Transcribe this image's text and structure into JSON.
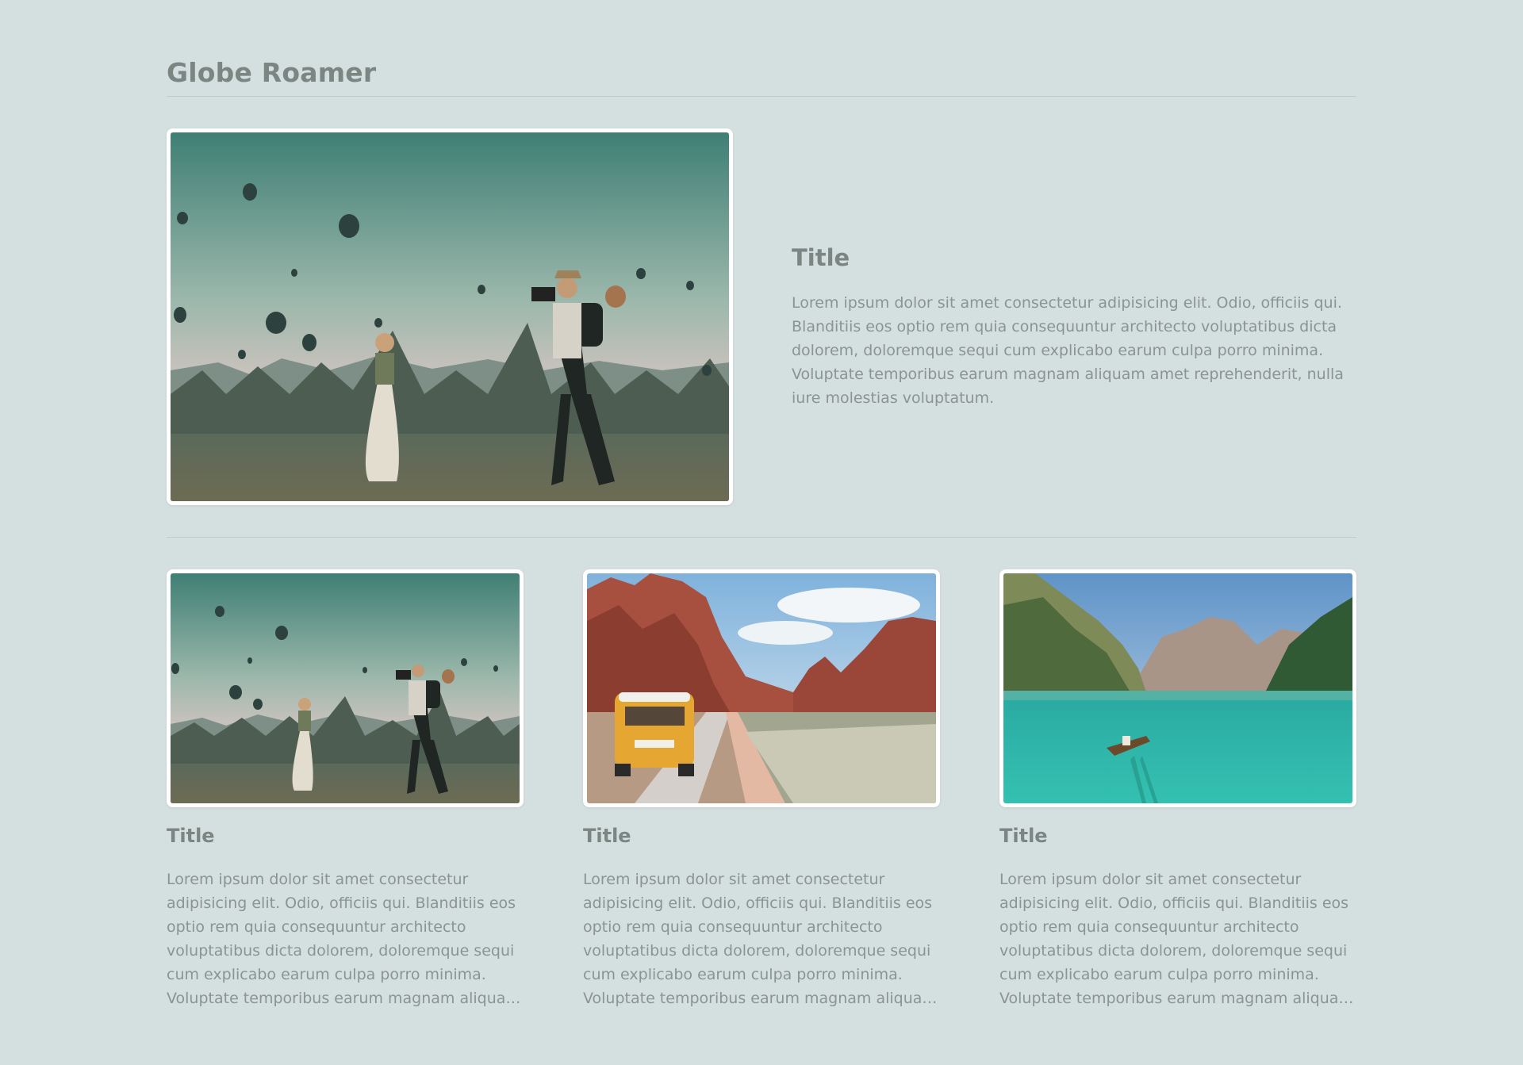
{
  "site": {
    "title": "Globe Roamer"
  },
  "featured": {
    "title": "Title",
    "body": "Lorem ipsum dolor sit amet consectetur adipisicing elit. Odio, officiis qui. Blanditiis eos optio rem quia consequuntur architecto voluptatibus dicta dolorem, doloremque sequi cum explicabo earum culpa porro minima. Voluptate temporibus earum magnam aliquam amet reprehenderit, nulla iure molestias voluptatum.",
    "image": "hot-air-balloons-photographers"
  },
  "cards": [
    {
      "title": "Title",
      "body": "Lorem ipsum dolor sit amet consectetur adipisicing elit. Odio, officiis qui. Blanditiis eos optio rem quia consequuntur architecto voluptatibus dicta dolorem, doloremque sequi cum explicabo earum culpa porro minima. Voluptate temporibus earum magnam aliquam amet reprehenderit, nulla iure molestias voluptatum.",
      "image": "hot-air-balloons-photographers"
    },
    {
      "title": "Title",
      "body": "Lorem ipsum dolor sit amet consectetur adipisicing elit. Odio, officiis qui. Blanditiis eos optio rem quia consequuntur architecto voluptatibus dicta dolorem, doloremque sequi cum explicabo earum culpa porro minima. Voluptate temporibus earum magnam aliquam amet reprehenderit, nulla iure molestias voluptatum.",
      "image": "yellow-van-desert-road"
    },
    {
      "title": "Title",
      "body": "Lorem ipsum dolor sit amet consectetur adipisicing elit. Odio, officiis qui. Blanditiis eos optio rem quia consequuntur architecto voluptatibus dicta dolorem, doloremque sequi cum explicabo earum culpa porro minima. Voluptate temporibus earum magnam aliquam amet reprehenderit, nulla iure molestias voluptatum.",
      "image": "mountain-lake-boat"
    }
  ],
  "colors": {
    "background": "#d4dfdf",
    "heading": "#7b8582",
    "body_text": "#8a9491",
    "divider": "#bfcccb",
    "frame": "#ffffff"
  }
}
